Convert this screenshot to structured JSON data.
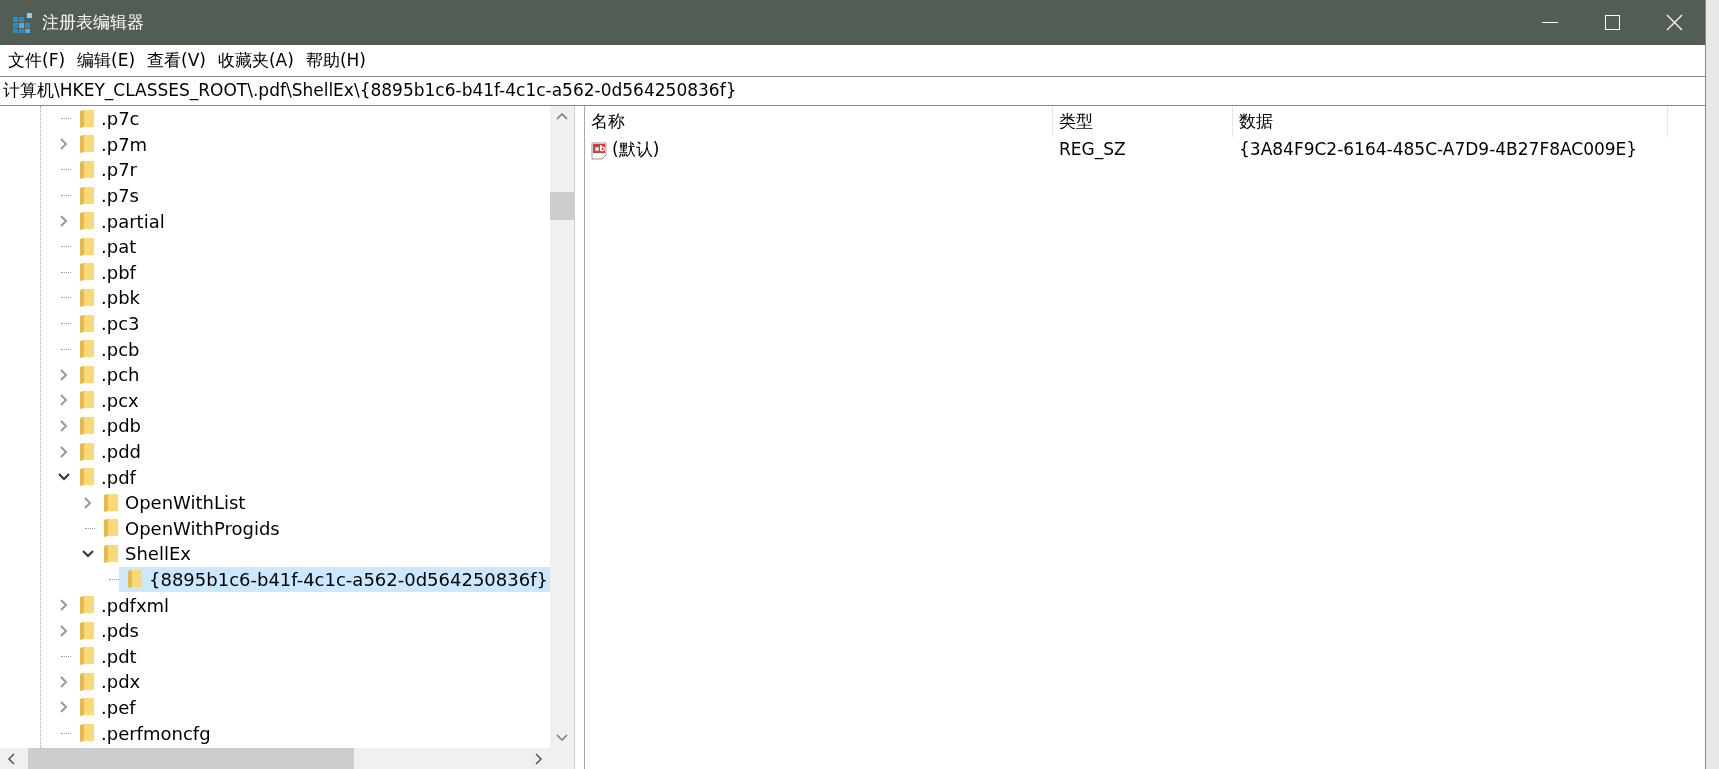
{
  "window": {
    "title": "注册表编辑器"
  },
  "menu": [
    "文件(F)",
    "编辑(E)",
    "查看(V)",
    "收藏夹(A)",
    "帮助(H)"
  ],
  "address": "计算机\\HKEY_CLASSES_ROOT\\.pdf\\ShellEx\\{8895b1c6-b41f-4c1c-a562-0d564250836f}",
  "tree": [
    {
      "label": ".p7c",
      "kind": "leaf",
      "selected": false
    },
    {
      "label": ".p7m",
      "kind": "branch",
      "expanded": false,
      "selected": false
    },
    {
      "label": ".p7r",
      "kind": "leaf",
      "selected": false
    },
    {
      "label": ".p7s",
      "kind": "leaf",
      "selected": false
    },
    {
      "label": ".partial",
      "kind": "branch",
      "expanded": false,
      "selected": false
    },
    {
      "label": ".pat",
      "kind": "leaf",
      "selected": false
    },
    {
      "label": ".pbf",
      "kind": "leaf",
      "selected": false
    },
    {
      "label": ".pbk",
      "kind": "leaf",
      "selected": false
    },
    {
      "label": ".pc3",
      "kind": "leaf",
      "selected": false
    },
    {
      "label": ".pcb",
      "kind": "leaf",
      "selected": false
    },
    {
      "label": ".pch",
      "kind": "branch",
      "expanded": false,
      "selected": false
    },
    {
      "label": ".pcx",
      "kind": "branch",
      "expanded": false,
      "selected": false
    },
    {
      "label": ".pdb",
      "kind": "branch",
      "expanded": false,
      "selected": false
    },
    {
      "label": ".pdd",
      "kind": "branch",
      "expanded": false,
      "selected": false
    },
    {
      "label": ".pdf",
      "kind": "branch",
      "expanded": true,
      "selected": false,
      "children": [
        {
          "label": "OpenWithList",
          "kind": "branch",
          "expanded": false,
          "selected": false
        },
        {
          "label": "OpenWithProgids",
          "kind": "leaf",
          "selected": false
        },
        {
          "label": "ShellEx",
          "kind": "branch",
          "expanded": true,
          "selected": false,
          "children": [
            {
              "label": "{8895b1c6-b41f-4c1c-a562-0d564250836f}",
              "kind": "leaf",
              "selected": true
            }
          ]
        }
      ]
    },
    {
      "label": ".pdfxml",
      "kind": "branch",
      "expanded": false,
      "selected": false
    },
    {
      "label": ".pds",
      "kind": "branch",
      "expanded": false,
      "selected": false
    },
    {
      "label": ".pdt",
      "kind": "leaf",
      "selected": false
    },
    {
      "label": ".pdx",
      "kind": "branch",
      "expanded": false,
      "selected": false
    },
    {
      "label": ".pef",
      "kind": "branch",
      "expanded": false,
      "selected": false
    },
    {
      "label": ".perfmoncfg",
      "kind": "leaf",
      "selected": false
    }
  ],
  "table": {
    "columns": [
      "名称",
      "类型",
      "数据"
    ],
    "rows": [
      {
        "name": "(默认)",
        "type": "REG_SZ",
        "data": "{3A84F9C2-6164-485C-A7D9-4B27F8AC009E}"
      }
    ]
  }
}
